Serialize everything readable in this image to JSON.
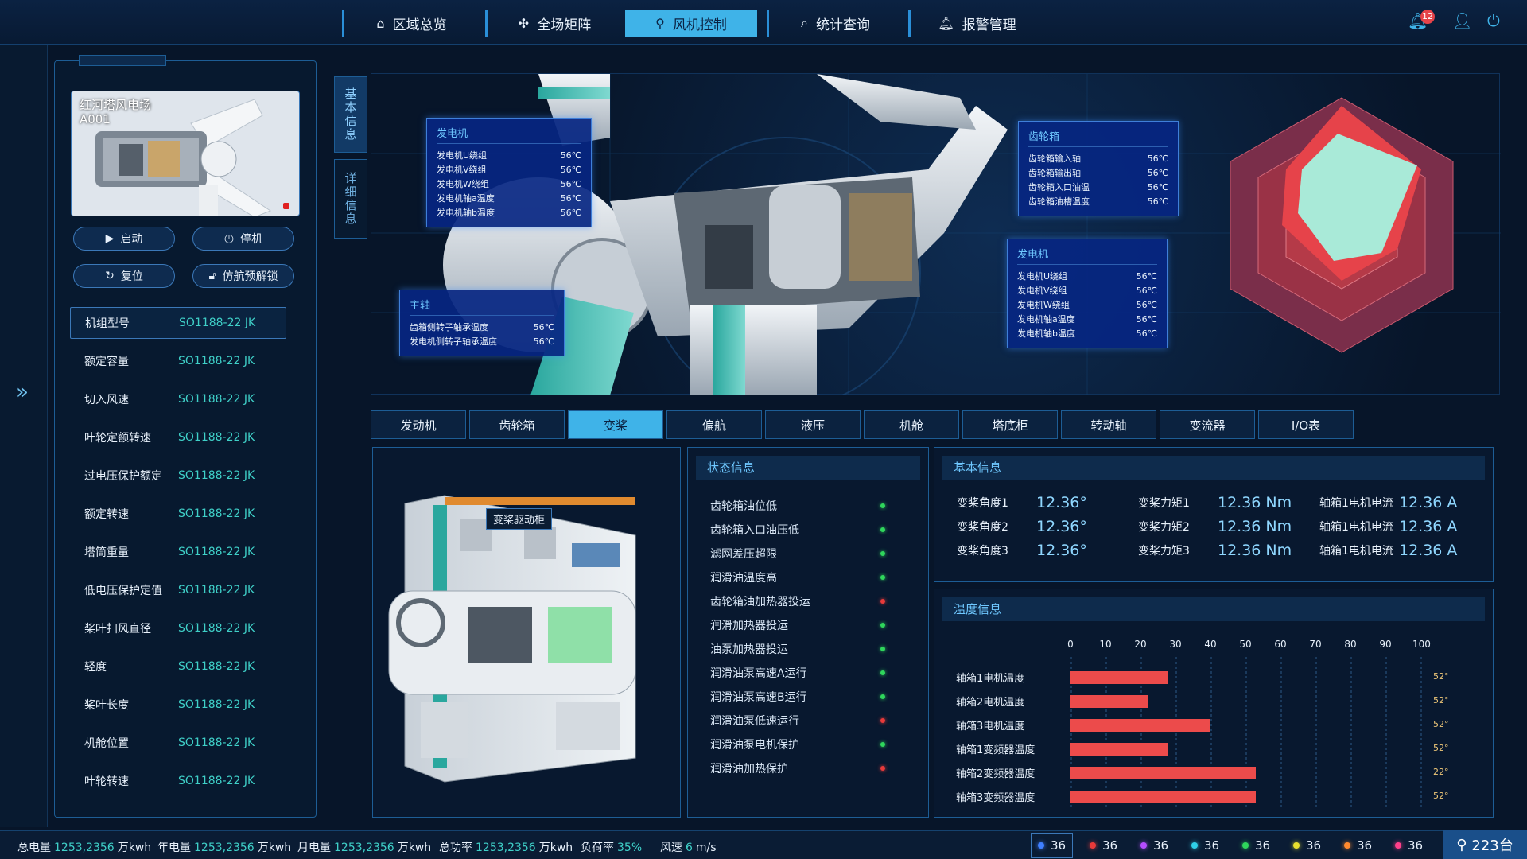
{
  "nav": {
    "items": [
      {
        "label": "区域总览",
        "icon": "home-icon"
      },
      {
        "label": "全场矩阵",
        "icon": "fan-icon"
      },
      {
        "label": "风机控制",
        "icon": "turbine-icon"
      },
      {
        "label": "统计查询",
        "icon": "search-icon"
      },
      {
        "label": "报警管理",
        "icon": "bell-icon"
      }
    ],
    "active": "风机控制",
    "notification_count": "12"
  },
  "sidebar_toggle": "»",
  "turbine": {
    "site": "红河塔风电场",
    "id": "A001"
  },
  "actions": {
    "start": "启动",
    "stop": "停机",
    "reset": "复位",
    "unlock": "仿航预解锁"
  },
  "specs": [
    {
      "label": "机组型号",
      "value": "SO1188-22 JK"
    },
    {
      "label": "额定容量",
      "value": "SO1188-22 JK"
    },
    {
      "label": "切入风速",
      "value": "SO1188-22 JK"
    },
    {
      "label": "叶轮定额转速",
      "value": "SO1188-22 JK"
    },
    {
      "label": "过电压保护额定",
      "value": "SO1188-22 JK"
    },
    {
      "label": "额定转速",
      "value": "SO1188-22 JK"
    },
    {
      "label": "塔筒重量",
      "value": "SO1188-22 JK"
    },
    {
      "label": "低电压保护定值",
      "value": "SO1188-22 JK"
    },
    {
      "label": "桨叶扫风直径",
      "value": "SO1188-22 JK"
    },
    {
      "label": "轻度",
      "value": "SO1188-22 JK"
    },
    {
      "label": "桨叶长度",
      "value": "SO1188-22 JK"
    },
    {
      "label": "机舱位置",
      "value": "SO1188-22 JK"
    },
    {
      "label": "叶轮转速",
      "value": "SO1188-22 JK"
    }
  ],
  "vertical_tabs": {
    "basic": "基本信息",
    "detail": "详细信息"
  },
  "infoboxes": {
    "gen1": {
      "title": "发电机",
      "rows": [
        {
          "k": "发电机U绕组",
          "v": "56℃"
        },
        {
          "k": "发电机V绕组",
          "v": "56℃"
        },
        {
          "k": "发电机W绕组",
          "v": "56℃"
        },
        {
          "k": "发电机轴a温度",
          "v": "56℃"
        },
        {
          "k": "发电机轴b温度",
          "v": "56℃"
        }
      ]
    },
    "gear": {
      "title": "齿轮箱",
      "rows": [
        {
          "k": "齿轮箱输入轴",
          "v": "56℃"
        },
        {
          "k": "齿轮箱输出轴",
          "v": "56℃"
        },
        {
          "k": "齿轮箱入口油温",
          "v": "56℃"
        },
        {
          "k": "齿轮箱油槽温度",
          "v": "56℃"
        }
      ]
    },
    "gen2": {
      "title": "发电机",
      "rows": [
        {
          "k": "发电机U绕组",
          "v": "56℃"
        },
        {
          "k": "发电机V绕组",
          "v": "56℃"
        },
        {
          "k": "发电机W绕组",
          "v": "56℃"
        },
        {
          "k": "发电机轴a温度",
          "v": "56℃"
        },
        {
          "k": "发电机轴b温度",
          "v": "56℃"
        }
      ]
    },
    "shaft": {
      "title": "主轴",
      "rows": [
        {
          "k": "齿箱侧转子轴承温度",
          "v": "56℃"
        },
        {
          "k": "发电机侧转子轴承温度",
          "v": "56℃"
        }
      ]
    }
  },
  "subtabs": [
    "发动机",
    "齿轮箱",
    "变桨",
    "偏航",
    "液压",
    "机舱",
    "塔底柜",
    "转动轴",
    "变流器",
    "I/O表"
  ],
  "active_subtab": "变桨",
  "component_label": "变桨驱动柜",
  "status": {
    "title": "状态信息",
    "items": [
      {
        "label": "齿轮箱油位低",
        "state": "ok"
      },
      {
        "label": "齿轮箱入口油压低",
        "state": "ok"
      },
      {
        "label": "滤网差压超限",
        "state": "ok"
      },
      {
        "label": "润滑油温度高",
        "state": "ok"
      },
      {
        "label": "齿轮箱油加热器投运",
        "state": "alarm"
      },
      {
        "label": "润滑加热器投运",
        "state": "ok"
      },
      {
        "label": "油泵加热器投运",
        "state": "ok"
      },
      {
        "label": "润滑油泵高速A运行",
        "state": "ok"
      },
      {
        "label": "润滑油泵高速B运行",
        "state": "ok"
      },
      {
        "label": "润滑油泵低速运行",
        "state": "alarm"
      },
      {
        "label": "润滑油泵电机保护",
        "state": "ok"
      },
      {
        "label": "润滑油加热保护",
        "state": "alarm"
      }
    ],
    "colors": {
      "ok": "#2fd65c",
      "alarm": "#e83a3a"
    }
  },
  "basic_info": {
    "title": "基本信息",
    "rows": [
      [
        {
          "label": "变桨角度1",
          "value": "12.36°"
        },
        {
          "label": "变桨力矩1",
          "value": "12.36 Nm"
        },
        {
          "label": "轴箱1电机电流",
          "value": "12.36 A"
        }
      ],
      [
        {
          "label": "变桨角度2",
          "value": "12.36°"
        },
        {
          "label": "变桨力矩2",
          "value": "12.36 Nm"
        },
        {
          "label": "轴箱1电机电流",
          "value": "12.36 A"
        }
      ],
      [
        {
          "label": "变桨角度3",
          "value": "12.36°"
        },
        {
          "label": "变桨力矩3",
          "value": "12.36 Nm"
        },
        {
          "label": "轴箱1电机电流",
          "value": "12.36 A"
        }
      ]
    ]
  },
  "temperature": {
    "title": "温度信息",
    "axis_ticks": [
      "0",
      "10",
      "20",
      "30",
      "40",
      "50",
      "60",
      "70",
      "80",
      "90",
      "100"
    ],
    "bars": [
      {
        "label": "轴箱1电机温度",
        "value": 28,
        "text": "52°"
      },
      {
        "label": "轴箱2电机温度",
        "value": 22,
        "text": "52°"
      },
      {
        "label": "轴箱3电机温度",
        "value": 40,
        "text": "52°"
      },
      {
        "label": "轴箱1变频器温度",
        "value": 28,
        "text": "52°"
      },
      {
        "label": "轴箱2变频器温度",
        "value": 53,
        "text": "22°"
      },
      {
        "label": "轴箱3变频器温度",
        "value": 53,
        "text": "52°"
      }
    ],
    "bar_color": "#ec4b4b"
  },
  "footer": {
    "stats": [
      {
        "label": "总电量",
        "value": "1253,2356",
        "unit": "万kwh"
      },
      {
        "label": "年电量",
        "value": "1253,2356",
        "unit": "万kwh"
      },
      {
        "label": "月电量",
        "value": "1253,2356",
        "unit": "万kwh"
      },
      {
        "label": "总功率",
        "value": "1253,2356",
        "unit": "万kwh"
      },
      {
        "label": "负荷率",
        "value": "35%",
        "unit": ""
      },
      {
        "label": "风速",
        "value": "6",
        "unit": "m/s"
      }
    ],
    "chips": [
      {
        "count": "36",
        "color": "#3f7fff"
      },
      {
        "count": "36",
        "color": "#e83a3a"
      },
      {
        "count": "36",
        "color": "#b44dff"
      },
      {
        "count": "36",
        "color": "#2fd0e8"
      },
      {
        "count": "36",
        "color": "#2fd65c"
      },
      {
        "count": "36",
        "color": "#e8e02f"
      },
      {
        "count": "36",
        "color": "#ff8a2f"
      },
      {
        "count": "36",
        "color": "#ff3f8a"
      }
    ],
    "turbine_total": "223台"
  }
}
